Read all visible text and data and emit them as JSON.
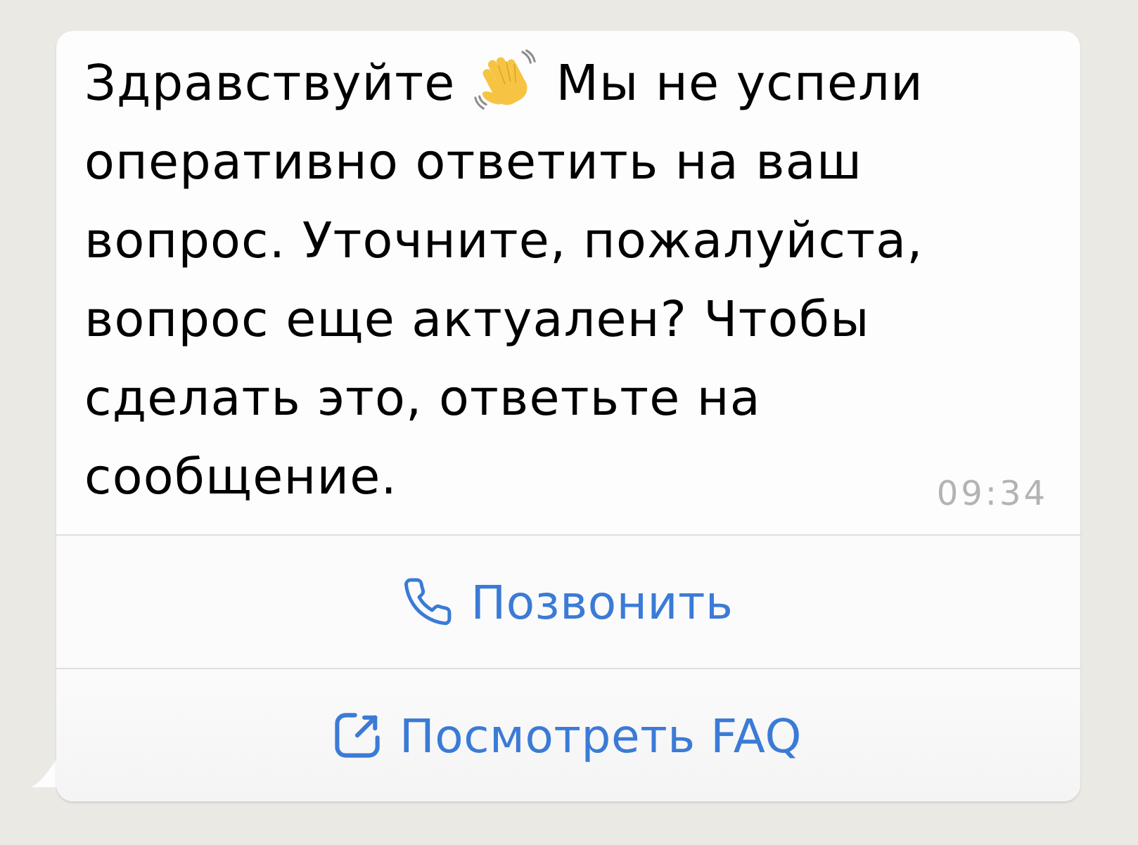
{
  "message": {
    "greeting": "Здравствуйте",
    "text": "Мы не успели оперативно ответить на ваш вопрос. Уточните, пожалуйста, вопрос еще актуален? Чтобы сделать это, ответьте на сообщение.",
    "time": "09:34"
  },
  "buttons": [
    {
      "kind": "call",
      "label": "Позвонить"
    },
    {
      "kind": "link",
      "label": "Посмотреть FAQ"
    }
  ]
}
